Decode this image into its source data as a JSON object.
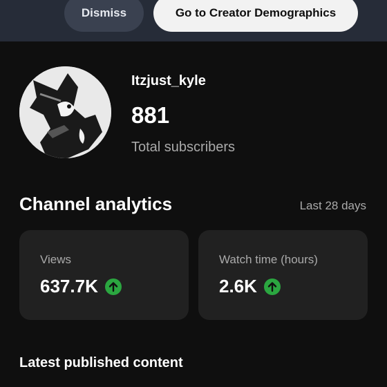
{
  "banner": {
    "dismiss_label": "Dismiss",
    "demographics_label": "Go to Creator Demographics"
  },
  "channel": {
    "name": "Itzjust_kyle",
    "subscriber_count": "881",
    "subscriber_label": "Total subscribers"
  },
  "analytics": {
    "title": "Channel analytics",
    "period": "Last 28 days",
    "cards": [
      {
        "label": "Views",
        "value": "637.7K",
        "trend_icon": "arrow-up-circle-icon"
      },
      {
        "label": "Watch time (hours)",
        "value": "2.6K",
        "trend_icon": "arrow-up-circle-icon"
      }
    ]
  },
  "latest": {
    "title": "Latest published content"
  },
  "colors": {
    "background": "#0f0f0f",
    "banner": "#262c38",
    "card": "#212121",
    "trend_up": "#2ba640"
  }
}
